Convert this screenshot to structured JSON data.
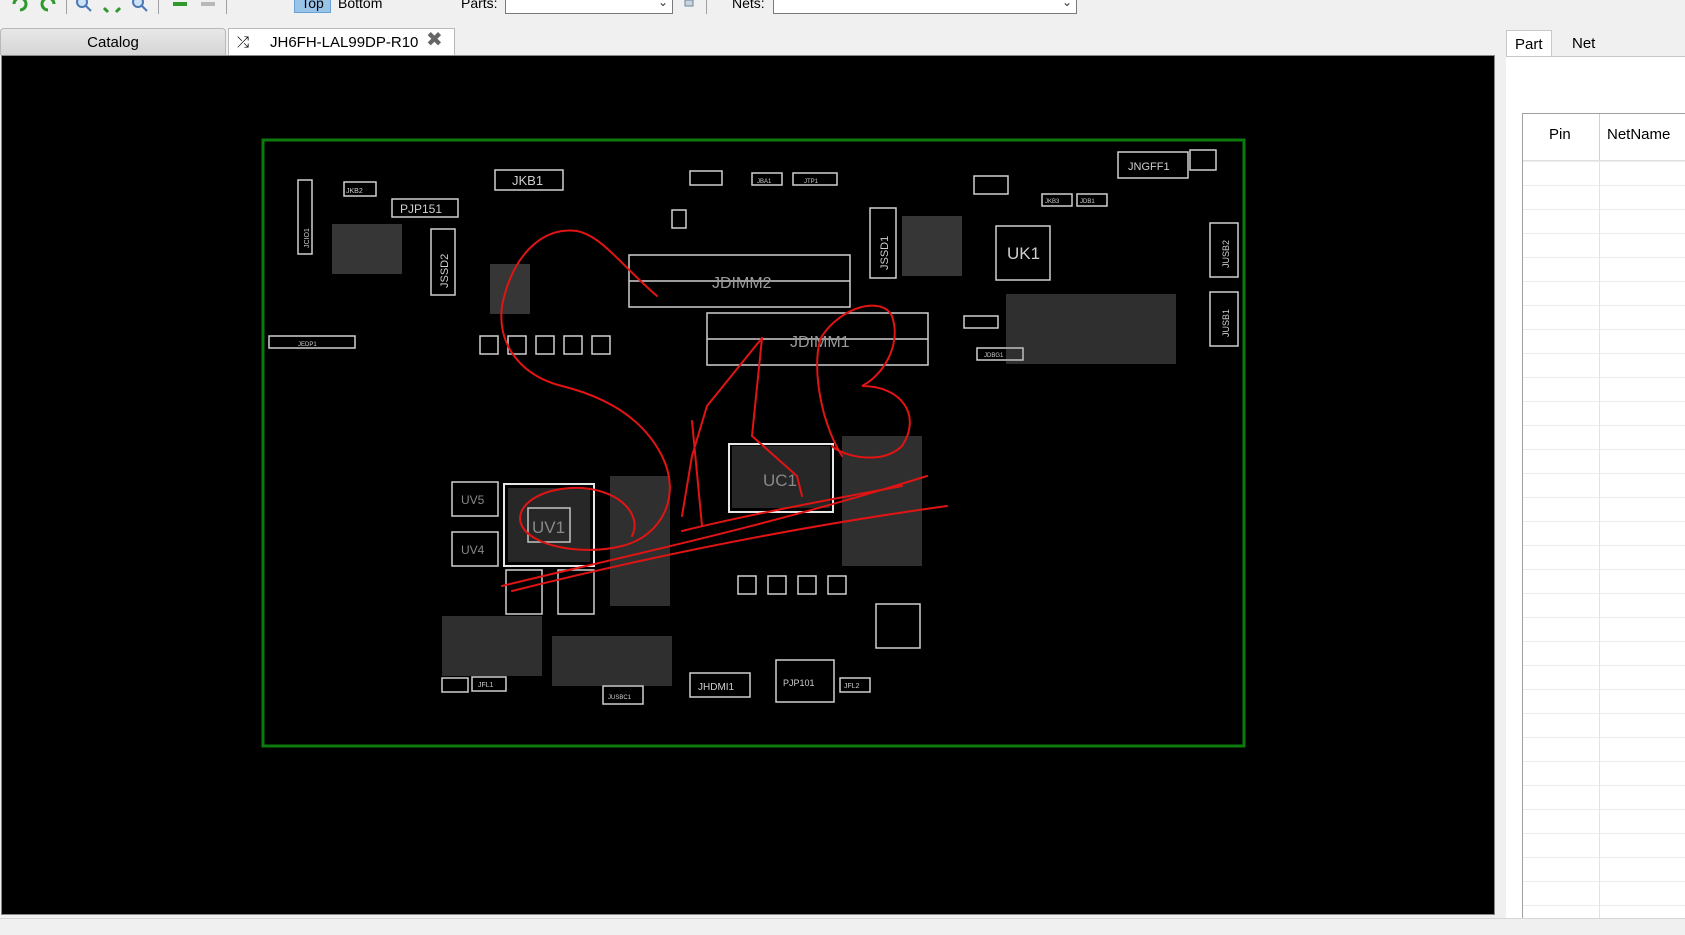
{
  "toolbar": {
    "view_top": "Top",
    "view_bottom": "Bottom",
    "parts_label": "Parts:",
    "parts_value": "",
    "nets_label": "Nets:",
    "nets_value": ""
  },
  "tabs": {
    "catalog": "Catalog",
    "board": "JH6FH-LAL99DP-R10"
  },
  "right_panel": {
    "tab_part": "Part",
    "tab_net": "Net",
    "col_pin": "Pin",
    "col_netname": "NetName"
  },
  "board_labels": {
    "jkb1": "JKB1",
    "jkb2": "JKB2",
    "pjp151": "PJP151",
    "jssd2": "JSSD2",
    "jssd1": "JSSD1",
    "jdimm2": "JDIMM2",
    "jdimm1": "JDIMM1",
    "uk1": "UK1",
    "jngff1": "JNGFF1",
    "jusb2": "JUSB2",
    "jusb1": "JUSB1",
    "uc1": "UC1",
    "uv1": "UV1",
    "uv5": "UV5",
    "uv4": "UV4",
    "jhdmi1": "JHDMI1",
    "pjp101": "PJP101",
    "jfl1": "JFL1",
    "jfl2": "JFL2",
    "jedp1": "JEDP1",
    "jkb3": "JKB3",
    "jdb1": "JDB1",
    "jdbg1": "JDBG1",
    "jusbc1": "JUSBC1",
    "jba1": "JBA1",
    "jtp1": "JTP1",
    "jcio1": "JCIO1"
  },
  "colors": {
    "board_outline": "#0d7a0d",
    "silkscreen": "#cfcfcf",
    "annotation": "#e11414",
    "selected_view": "#9ac3e8"
  }
}
